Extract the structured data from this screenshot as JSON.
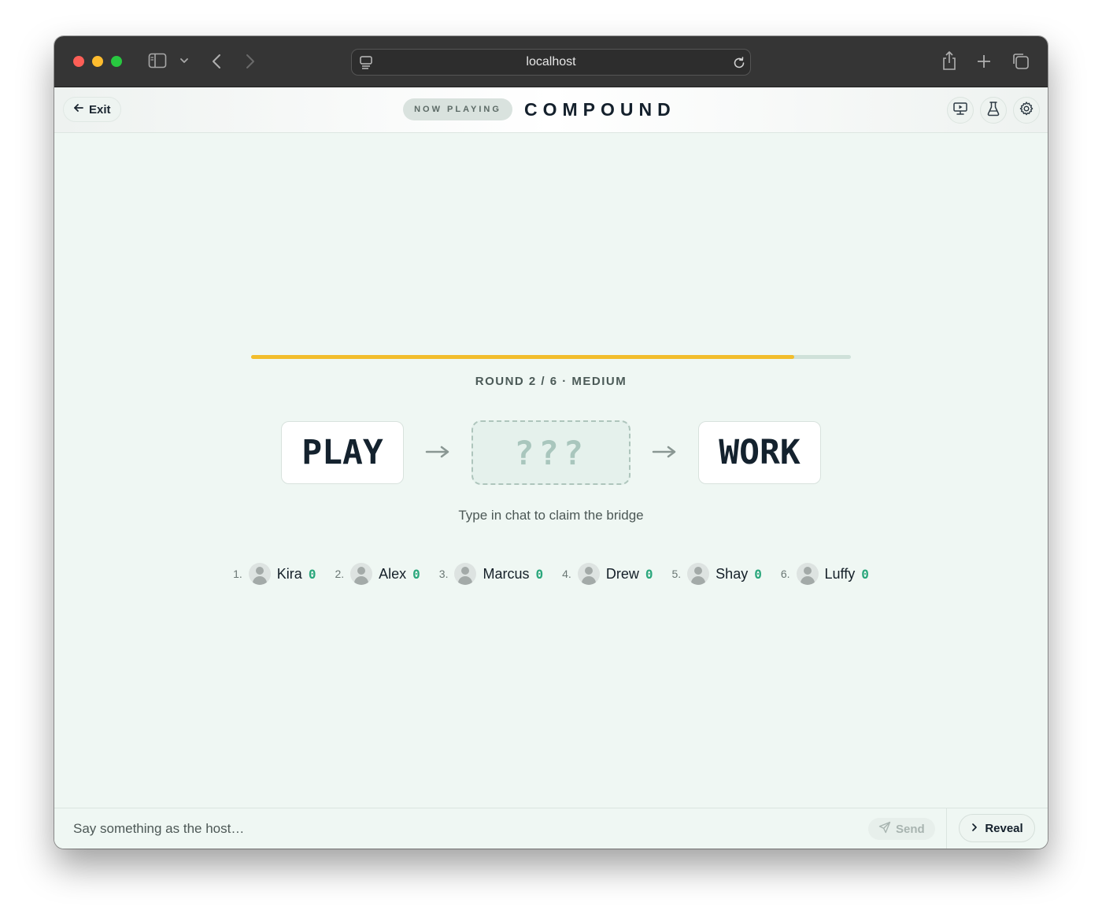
{
  "browser": {
    "url": "localhost",
    "icons": [
      "sidebar-icon",
      "chevron-down-icon",
      "back-icon",
      "forward-icon",
      "site-settings-icon",
      "reload-icon",
      "share-icon",
      "new-tab-icon",
      "tab-overview-icon"
    ]
  },
  "header": {
    "exit_label": "Exit",
    "now_playing_label": "NOW PLAYING",
    "game_title": "COMPOUND",
    "icons": [
      "presentation-icon",
      "flask-icon",
      "gear-icon"
    ]
  },
  "game": {
    "progress": 0.905,
    "progress_color": "#f2bd2c",
    "round_label": "ROUND 2 / 6 · MEDIUM",
    "left_word": "PLAY",
    "mystery_word": "???",
    "right_word": "WORK",
    "hint": "Type in chat to claim the bridge"
  },
  "players": [
    {
      "rank": "1.",
      "name": "Kira",
      "score": "0"
    },
    {
      "rank": "2.",
      "name": "Alex",
      "score": "0"
    },
    {
      "rank": "3.",
      "name": "Marcus",
      "score": "0"
    },
    {
      "rank": "4.",
      "name": "Drew",
      "score": "0"
    },
    {
      "rank": "5.",
      "name": "Shay",
      "score": "0"
    },
    {
      "rank": "6.",
      "name": "Luffy",
      "score": "0"
    }
  ],
  "chat": {
    "placeholder": "Say something as the host…",
    "send_label": "Send",
    "reveal_label": "Reveal"
  },
  "colors": {
    "accent_score": "#2aa77c",
    "background": "#eff7f3"
  }
}
